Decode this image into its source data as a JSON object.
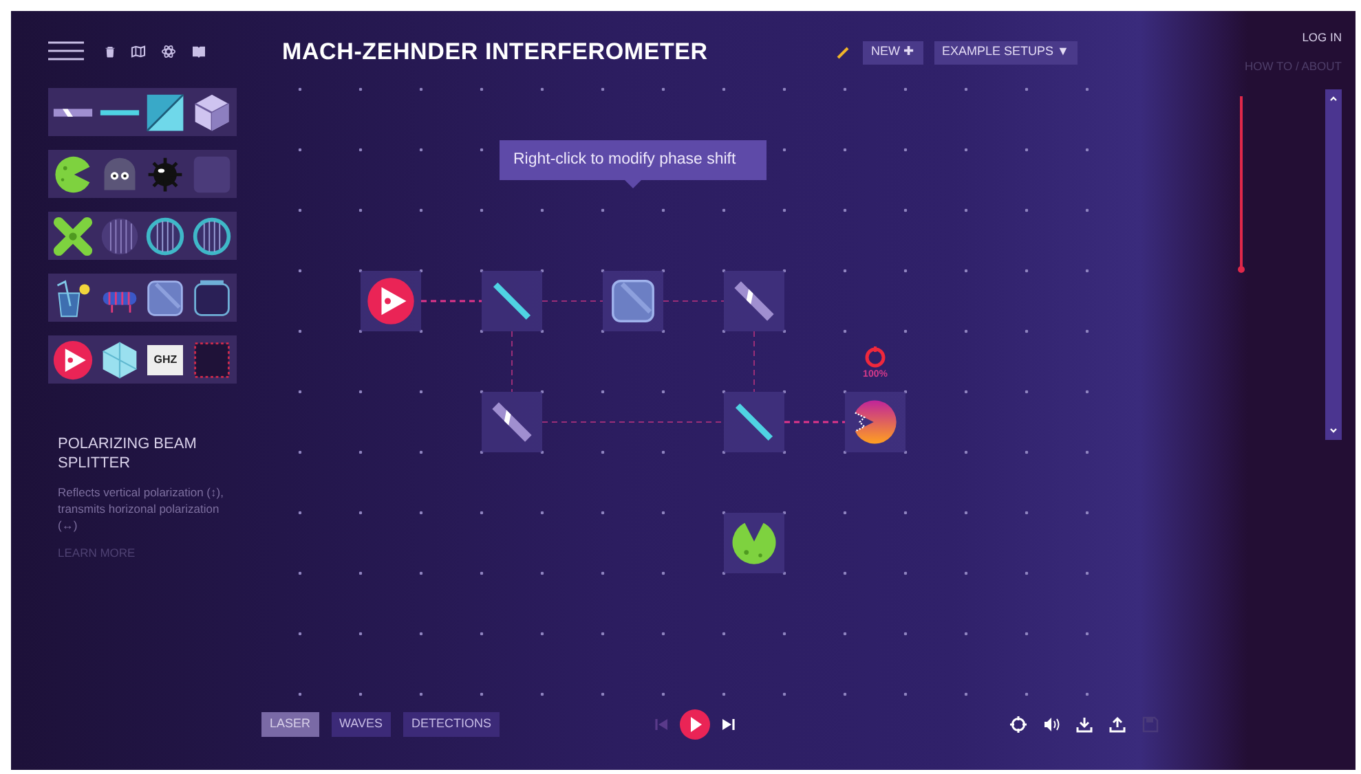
{
  "sidebar": {
    "nav_icons": [
      {
        "kind": "menu"
      },
      {
        "kind": "trash"
      },
      {
        "kind": "map"
      },
      {
        "kind": "atom"
      },
      {
        "kind": "book"
      }
    ],
    "toolbox": [
      [
        {
          "kind": "mirror"
        },
        {
          "kind": "thin-splitter"
        },
        {
          "kind": "splitter-cube"
        },
        {
          "kind": "rotator-cube"
        }
      ],
      [
        {
          "kind": "detector"
        },
        {
          "kind": "blob"
        },
        {
          "kind": "mine"
        },
        {
          "kind": "empty-slot"
        }
      ],
      [
        {
          "kind": "quarter-cross"
        },
        {
          "kind": "polarizer"
        },
        {
          "kind": "waveplate"
        },
        {
          "kind": "waveplate"
        }
      ],
      [
        {
          "kind": "sugar"
        },
        {
          "kind": "faraday"
        },
        {
          "kind": "glass"
        },
        {
          "kind": "jar"
        }
      ],
      [
        {
          "kind": "laser"
        },
        {
          "kind": "prism"
        },
        {
          "kind": "ghz",
          "label": "GHZ"
        },
        {
          "kind": "absorber-slot"
        }
      ]
    ],
    "description": {
      "title": "POLARIZING BEAM SPLITTER",
      "text": "Reflects vertical polarization (↕), transmits horizonal polarization (↔)",
      "link": "LEARN MORE"
    }
  },
  "header": {
    "title": "MACH-ZEHNDER INTERFEROMETER",
    "buttons": [
      {
        "label": "NEW ✚"
      },
      {
        "label": "EXAMPLE SETUPS ▼"
      }
    ]
  },
  "tooltip": "Right-click to modify phase shift",
  "board": {
    "rows": [
      {
        "cells": [
          {
            "kind": "empty"
          },
          {
            "kind": "empty"
          },
          {
            "kind": "empty"
          },
          {
            "kind": "empty"
          },
          {
            "kind": "empty"
          },
          {
            "kind": "empty"
          },
          {
            "kind": "empty"
          },
          {
            "kind": "empty"
          },
          {
            "kind": "empty"
          },
          {
            "kind": "empty"
          },
          {
            "kind": "empty"
          },
          {
            "kind": "empty"
          },
          {
            "kind": "empty"
          }
        ]
      },
      {
        "cells": [
          {
            "kind": "empty"
          },
          {
            "kind": "empty"
          },
          {
            "kind": "empty"
          },
          {
            "kind": "empty"
          },
          {
            "kind": "empty"
          },
          {
            "kind": "empty"
          },
          {
            "kind": "empty"
          },
          {
            "kind": "empty"
          },
          {
            "kind": "empty"
          },
          {
            "kind": "empty"
          },
          {
            "kind": "empty"
          },
          {
            "kind": "empty"
          },
          {
            "kind": "empty"
          }
        ]
      },
      {
        "cells": [
          {
            "kind": "empty"
          },
          {
            "kind": "empty"
          },
          {
            "kind": "empty"
          },
          {
            "kind": "empty"
          },
          {
            "kind": "empty"
          },
          {
            "kind": "empty"
          },
          {
            "kind": "empty"
          },
          {
            "kind": "empty"
          },
          {
            "kind": "empty"
          },
          {
            "kind": "empty"
          },
          {
            "kind": "empty"
          },
          {
            "kind": "empty"
          },
          {
            "kind": "empty"
          }
        ]
      },
      {
        "cells": [
          {
            "kind": "empty"
          },
          {
            "kind": "laser"
          },
          {
            "kind": "empty"
          },
          {
            "kind": "thin-splitter"
          },
          {
            "kind": "empty"
          },
          {
            "kind": "glass"
          },
          {
            "kind": "empty"
          },
          {
            "kind": "mirror"
          },
          {
            "kind": "empty"
          },
          {
            "kind": "empty"
          },
          {
            "kind": "empty"
          },
          {
            "kind": "empty"
          },
          {
            "kind": "empty"
          }
        ]
      },
      {
        "cells": [
          {
            "kind": "empty"
          },
          {
            "kind": "empty"
          },
          {
            "kind": "empty"
          },
          {
            "kind": "empty"
          },
          {
            "kind": "empty"
          },
          {
            "kind": "empty"
          },
          {
            "kind": "empty"
          },
          {
            "kind": "empty"
          },
          {
            "kind": "empty"
          },
          {
            "kind": "empty"
          },
          {
            "kind": "empty"
          },
          {
            "kind": "empty"
          },
          {
            "kind": "empty"
          }
        ]
      },
      {
        "cells": [
          {
            "kind": "empty"
          },
          {
            "kind": "empty"
          },
          {
            "kind": "empty"
          },
          {
            "kind": "mirror"
          },
          {
            "kind": "empty"
          },
          {
            "kind": "empty"
          },
          {
            "kind": "empty"
          },
          {
            "kind": "thin-splitter"
          },
          {
            "kind": "empty"
          },
          {
            "kind": "detector-left",
            "hit": true,
            "reading": "100%"
          },
          {
            "kind": "empty"
          },
          {
            "kind": "empty"
          },
          {
            "kind": "empty"
          }
        ]
      },
      {
        "cells": [
          {
            "kind": "empty"
          },
          {
            "kind": "empty"
          },
          {
            "kind": "empty"
          },
          {
            "kind": "empty"
          },
          {
            "kind": "empty"
          },
          {
            "kind": "empty"
          },
          {
            "kind": "empty"
          },
          {
            "kind": "empty"
          },
          {
            "kind": "empty"
          },
          {
            "kind": "empty"
          },
          {
            "kind": "empty"
          },
          {
            "kind": "empty"
          },
          {
            "kind": "empty"
          }
        ]
      },
      {
        "cells": [
          {
            "kind": "empty"
          },
          {
            "kind": "empty"
          },
          {
            "kind": "empty"
          },
          {
            "kind": "empty"
          },
          {
            "kind": "empty"
          },
          {
            "kind": "empty"
          },
          {
            "kind": "empty"
          },
          {
            "kind": "detector-up",
            "hit": false
          },
          {
            "kind": "empty"
          },
          {
            "kind": "empty"
          },
          {
            "kind": "empty"
          },
          {
            "kind": "empty"
          },
          {
            "kind": "empty"
          }
        ]
      },
      {
        "cells": [
          {
            "kind": "empty"
          },
          {
            "kind": "empty"
          },
          {
            "kind": "empty"
          },
          {
            "kind": "empty"
          },
          {
            "kind": "empty"
          },
          {
            "kind": "empty"
          },
          {
            "kind": "empty"
          },
          {
            "kind": "empty"
          },
          {
            "kind": "empty"
          },
          {
            "kind": "empty"
          },
          {
            "kind": "empty"
          },
          {
            "kind": "empty"
          },
          {
            "kind": "empty"
          }
        ]
      },
      {
        "cells": [
          {
            "kind": "empty"
          },
          {
            "kind": "empty"
          },
          {
            "kind": "empty"
          },
          {
            "kind": "empty"
          },
          {
            "kind": "empty"
          },
          {
            "kind": "empty"
          },
          {
            "kind": "empty"
          },
          {
            "kind": "empty"
          },
          {
            "kind": "empty"
          },
          {
            "kind": "empty"
          },
          {
            "kind": "empty"
          },
          {
            "kind": "empty"
          },
          {
            "kind": "empty"
          }
        ]
      }
    ]
  },
  "bottom_bar": {
    "tabs": [
      {
        "label": "LASER",
        "selected": true
      },
      {
        "label": "WAVES",
        "selected": false
      },
      {
        "label": "DETECTIONS",
        "selected": false
      }
    ],
    "playback": [
      {
        "kind": "step-back",
        "disabled": true
      },
      {
        "kind": "play",
        "disabled": false
      },
      {
        "kind": "step-forward",
        "disabled": false
      }
    ],
    "tools": [
      {
        "kind": "reset",
        "disabled": false
      },
      {
        "kind": "sound",
        "disabled": false
      },
      {
        "kind": "download",
        "disabled": false
      },
      {
        "kind": "upload",
        "disabled": false
      },
      {
        "kind": "save",
        "disabled": true
      }
    ]
  },
  "right_panel": {
    "links": [
      "LOG IN",
      "HOW TO / ABOUT"
    ]
  }
}
